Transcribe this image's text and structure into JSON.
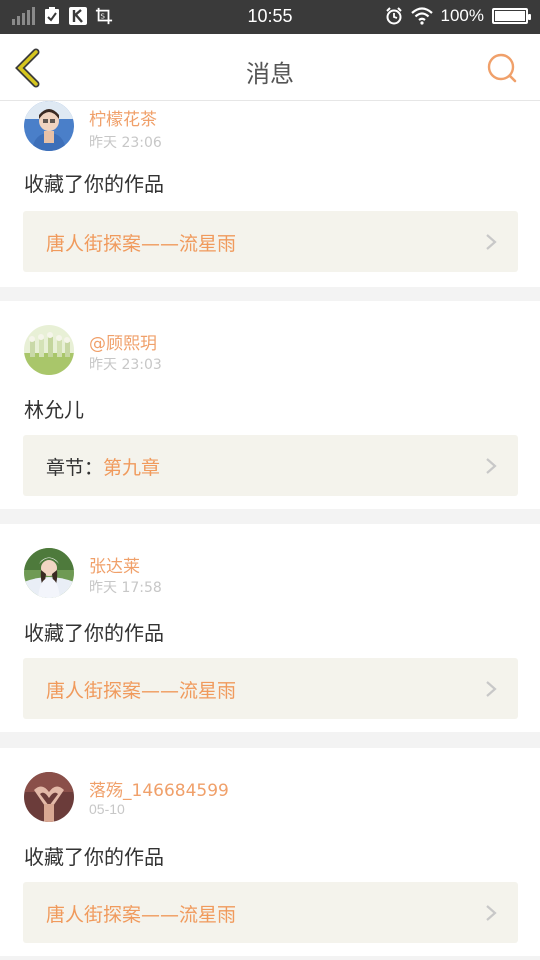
{
  "status": {
    "time": "10:55",
    "battery": "100%"
  },
  "header": {
    "title": "消息"
  },
  "colors": {
    "accent": "#f0a06a",
    "link": "#f09a5c",
    "back_arrow": "#d6c61f",
    "box_bg": "#f4f3ec"
  },
  "items": [
    {
      "name": "柠檬花茶",
      "time": "昨天 23:06",
      "text": "收藏了你的作品",
      "box_prefix": "",
      "box_link": "唐人街探案——流星雨"
    },
    {
      "name": "@顾熙玥",
      "time": "昨天 23:03",
      "text": "林允儿",
      "box_prefix": "章节：",
      "box_link": "第九章"
    },
    {
      "name": "张达莱",
      "time": "昨天 17:58",
      "text": "收藏了你的作品",
      "box_prefix": "",
      "box_link": "唐人街探案——流星雨"
    },
    {
      "name": "落殇_146684599",
      "time": "05-10",
      "text": "收藏了你的作品",
      "box_prefix": "",
      "box_link": "唐人街探案——流星雨"
    }
  ]
}
